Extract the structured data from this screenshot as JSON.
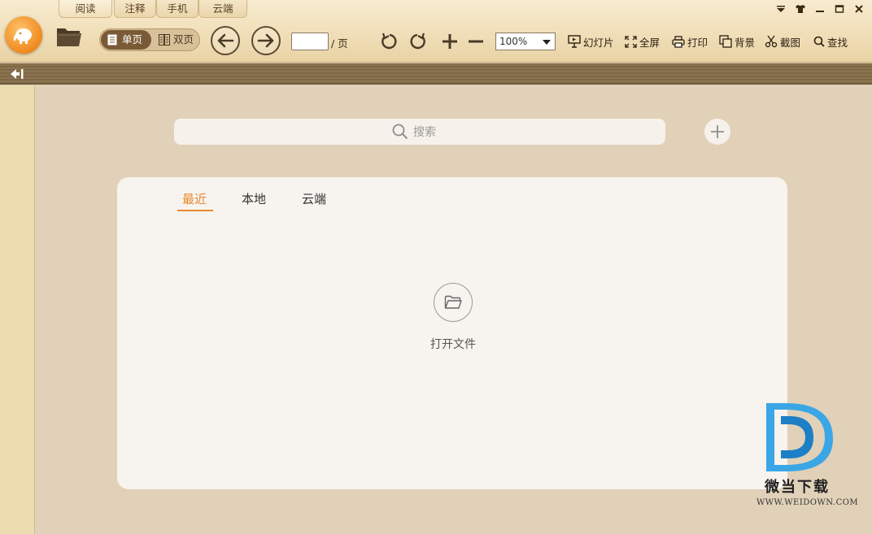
{
  "tabs": [
    {
      "label": "阅读",
      "active": true
    },
    {
      "label": "注释",
      "active": false
    },
    {
      "label": "手机",
      "active": false
    },
    {
      "label": "云端",
      "active": false
    }
  ],
  "view_mode": {
    "single": "单页",
    "double": "双页"
  },
  "page": {
    "value": "",
    "separator": "/ 页"
  },
  "zoom": {
    "value": "100%"
  },
  "tools": {
    "slideshow": "幻灯片",
    "fullscreen": "全屏",
    "print": "打印",
    "background": "背景",
    "screenshot": "截图",
    "find": "查找"
  },
  "search": {
    "placeholder": "搜索"
  },
  "library_tabs": [
    {
      "label": "最近",
      "active": true
    },
    {
      "label": "本地",
      "active": false
    },
    {
      "label": "云端",
      "active": false
    }
  ],
  "open_file": {
    "label": "打开文件"
  },
  "watermark": {
    "name": "微当下载",
    "url": "WWW.WEIDOWN.COM"
  },
  "colors": {
    "accent": "#e8892c",
    "toolbar": "#f2e1bd",
    "strip": "#7e6845"
  }
}
